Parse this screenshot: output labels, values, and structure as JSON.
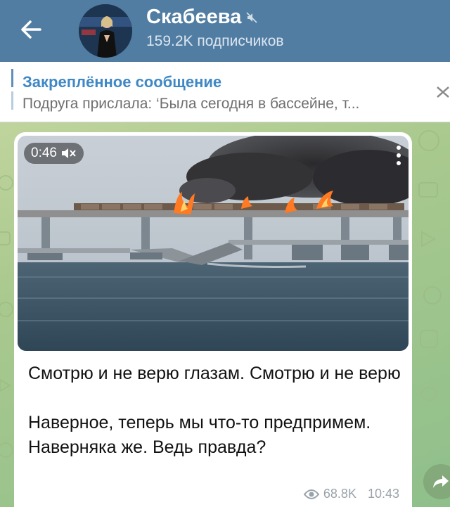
{
  "header": {
    "title": "Скабеева",
    "subscribers": "159.2K подписчиков"
  },
  "pinned": {
    "label": "Закреплённое сообщение",
    "preview": "Подруга прислала: ‘Была сегодня в бассейне, т..."
  },
  "message": {
    "video_duration": "0:46",
    "text": "Смотрю и не верю глазам. Смотрю и не верю\n\nНаверное, теперь мы что-то предпримем. Наверняка же. Ведь правда?",
    "views": "68.8K",
    "time": "10:43"
  },
  "colors": {
    "header_bg": "#517da2",
    "accent": "#3f88c5"
  },
  "icons": {
    "back": "arrow-left-icon",
    "mute": "mute-icon",
    "close_pin": "close-icon",
    "sound_off": "sound-off-icon",
    "more": "more-vertical-icon",
    "views": "eye-icon",
    "share": "share-arrow-icon"
  }
}
